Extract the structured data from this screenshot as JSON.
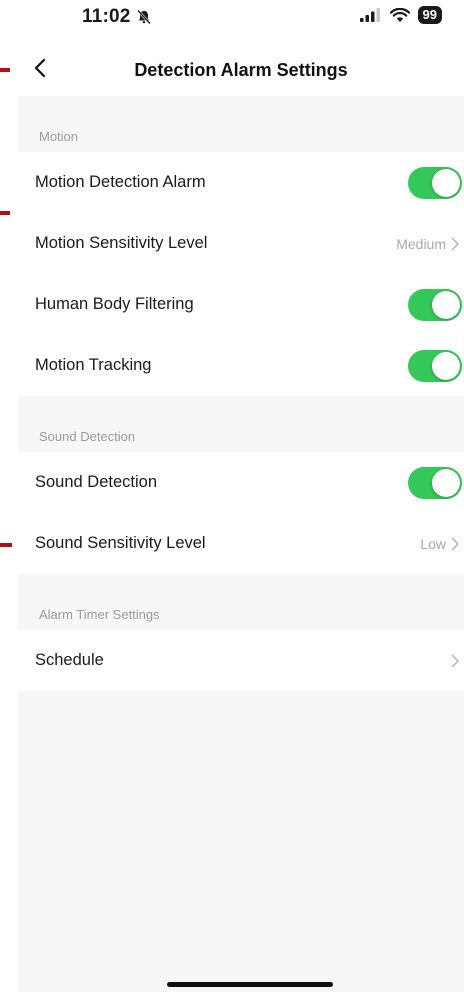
{
  "status_bar": {
    "time": "11:02",
    "battery": "99",
    "icons": [
      "bell-slash-icon",
      "signal-icon",
      "wifi-icon"
    ]
  },
  "header": {
    "title": "Detection Alarm Settings",
    "back_icon": "chevron-left-icon"
  },
  "sections": {
    "motion": {
      "header": "Motion",
      "rows": {
        "motion_detection_alarm": {
          "label": "Motion Detection Alarm",
          "toggle": "on"
        },
        "motion_sensitivity_level": {
          "label": "Motion Sensitivity Level",
          "value": "Medium"
        },
        "human_body_filtering": {
          "label": "Human Body Filtering",
          "toggle": "on"
        },
        "motion_tracking": {
          "label": "Motion Tracking",
          "toggle": "on"
        }
      }
    },
    "sound": {
      "header": "Sound Detection",
      "rows": {
        "sound_detection": {
          "label": "Sound Detection",
          "toggle": "on"
        },
        "sound_sensitivity_level": {
          "label": "Sound Sensitivity Level",
          "value": "Low"
        }
      }
    },
    "timer": {
      "header": "Alarm Timer Settings",
      "rows": {
        "schedule": {
          "label": "Schedule"
        }
      }
    }
  },
  "colors": {
    "toggle_on": "#34c759",
    "background": "#f7f7f7",
    "marker": "#b00f14"
  }
}
